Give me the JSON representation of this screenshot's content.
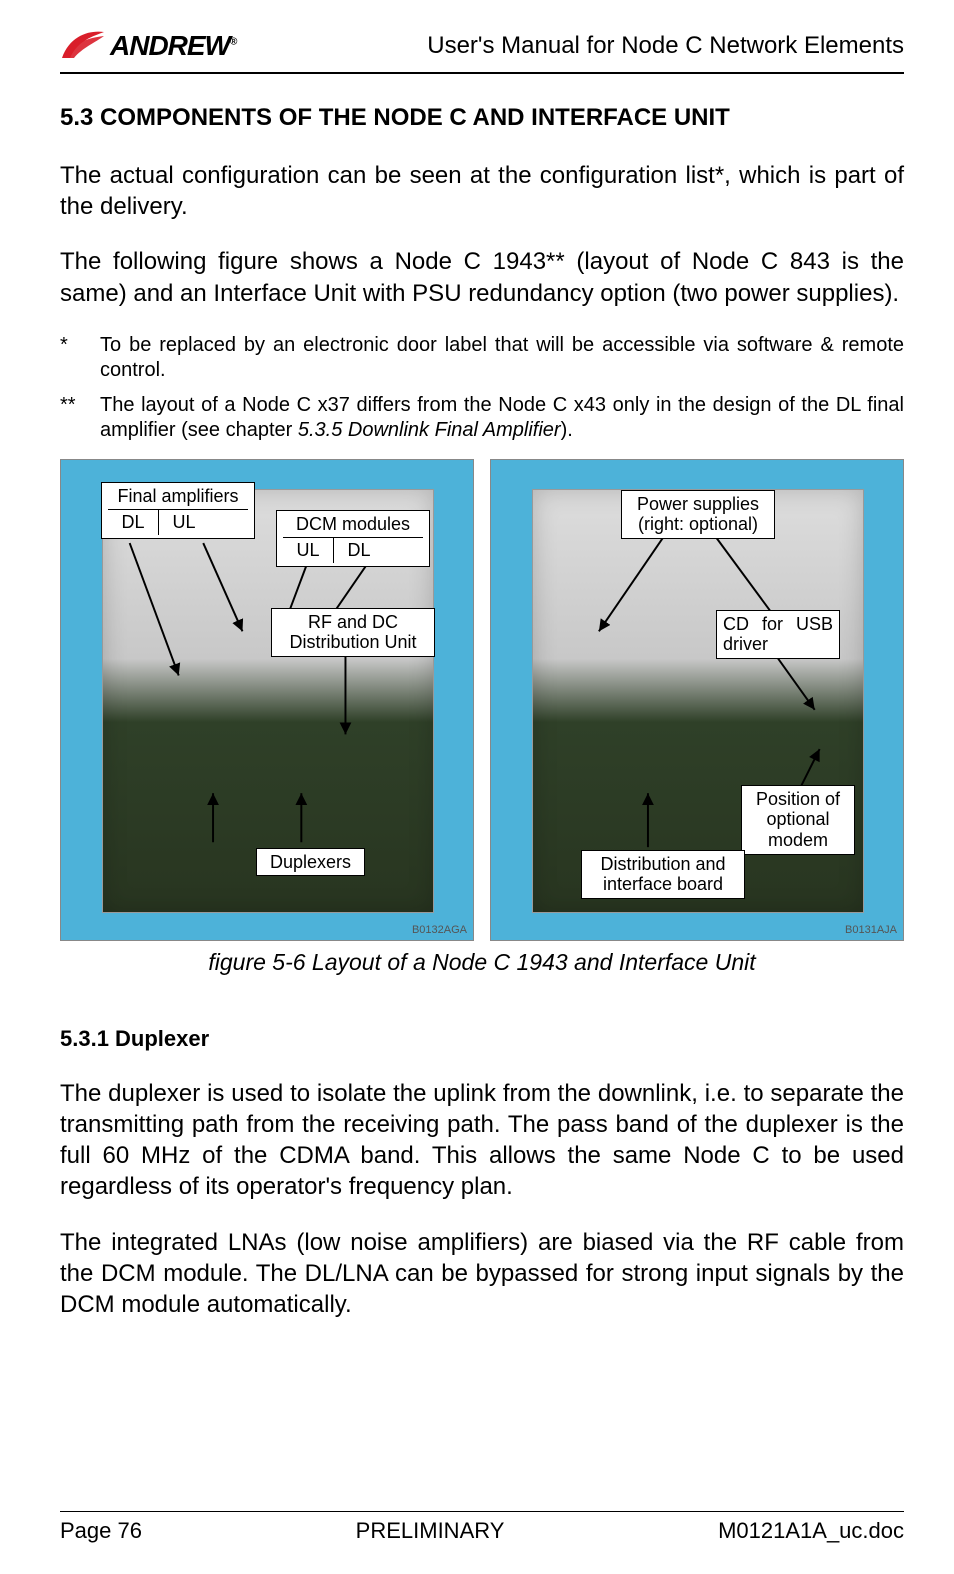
{
  "header": {
    "brand": "ANDREW",
    "brand_reg": "®",
    "doc_title": "User's Manual for Node C Network Elements"
  },
  "section_5_3": {
    "heading": "5.3   COMPONENTS OF THE NODE C AND INTERFACE UNIT",
    "para1": "The actual configuration can be seen at the configuration list*, which is part of the delivery.",
    "para2": "The following figure shows a Node C 1943** (layout of Node C 843 is the same) and an Interface Unit with PSU redundancy option (two power supplies).",
    "note1_mark": "*",
    "note1_text": "To be replaced by an electronic door label that will be accessible via software & remote control.",
    "note2_mark": "**",
    "note2_text_a": "The layout of a Node C x37 differs from the Node C x43 only in the design of the DL final amplifier (see chapter ",
    "note2_text_em": "5.3.5 Downlink Final Amplifier",
    "note2_text_b": ")."
  },
  "figure": {
    "left_ref": "B0132AGA",
    "right_ref": "B0131AJA",
    "caption": "figure 5-6 Layout of a Node C 1943 and Interface Unit",
    "callouts_left": {
      "final_amp": "Final amplifiers",
      "dl": "DL",
      "ul": "UL",
      "dcm": "DCM modules",
      "dcm_ul": "UL",
      "dcm_dl": "DL",
      "rfdc": "RF and DC Distribution Unit",
      "dup": "Duplexers"
    },
    "callouts_right": {
      "psu": "Power supplies (right: optional)",
      "cd": "CD for USB driver",
      "dist": "Distribution and interface board",
      "modem": "Position of optional modem"
    }
  },
  "section_5_3_1": {
    "heading": "5.3.1   Duplexer",
    "para1": "The duplexer is used to isolate the uplink from the downlink, i.e. to separate the transmitting path from the receiving path. The pass band of the duplexer is the full 60 MHz of the CDMA band. This allows the same Node C to be used regardless of its operator's frequency plan.",
    "para2": "The integrated LNAs (low noise amplifiers) are biased via the RF cable from the DCM module. The DL/LNA can be bypassed for strong input signals by the DCM module automatically."
  },
  "footer": {
    "page": "Page 76",
    "status": "PRELIMINARY",
    "file": "M0121A1A_uc.doc"
  }
}
